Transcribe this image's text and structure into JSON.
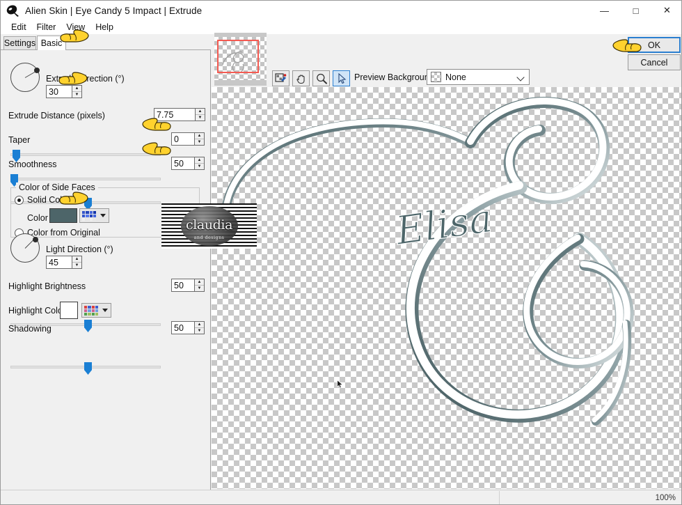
{
  "window": {
    "title": "Alien Skin | Eye Candy 5 Impact | Extrude",
    "app_icon": "alien-skin-icon",
    "minimize": "—",
    "maximize": "□",
    "close": "✕"
  },
  "menubar": {
    "items": [
      {
        "label": "Edit"
      },
      {
        "label": "Filter"
      },
      {
        "label": "View"
      },
      {
        "label": "Help"
      }
    ]
  },
  "tabs": [
    {
      "label": "Settings",
      "active": false
    },
    {
      "label": "Basic",
      "active": true
    }
  ],
  "settings": {
    "extrude_direction": {
      "label": "Extrude Direction (°)",
      "value": "30",
      "dial_angle_deg": 30
    },
    "extrude_distance": {
      "label": "Extrude Distance (pixels)",
      "value": "7.75",
      "slider_percent": 4
    },
    "taper": {
      "label": "Taper",
      "value": "0",
      "slider_percent": 0
    },
    "smoothness": {
      "label": "Smoothness",
      "value": "50",
      "slider_percent": 50
    },
    "color_of_side_faces": {
      "group_label": "Color of Side Faces",
      "solid_color_label": "Solid Color",
      "solid_color_selected": true,
      "color_label": "Color",
      "color_value": "#4d6569",
      "color_from_original_label": "Color from Original",
      "color_from_original_selected": false,
      "palette_button_name": "color-palette-dropdown"
    },
    "light_direction": {
      "label": "Light Direction (°)",
      "value": "45",
      "dial_angle_deg": 45
    },
    "highlight_brightness": {
      "label": "Highlight Brightness",
      "value": "50",
      "slider_percent": 50
    },
    "highlight_color": {
      "label": "Highlight Color",
      "value": "#ffffff",
      "palette_button_name": "highlight-color-palette-dropdown"
    },
    "shadowing": {
      "label": "Shadowing",
      "value": "50",
      "slider_percent": 50
    }
  },
  "toolbar": {
    "tools": [
      {
        "name": "eyedropper-tool",
        "active": false
      },
      {
        "name": "hand-tool",
        "active": false
      },
      {
        "name": "zoom-tool",
        "active": false
      },
      {
        "name": "pointer-tool",
        "active": true
      }
    ],
    "preview_background_label": "Preview Background:",
    "preview_background_value": "None"
  },
  "buttons": {
    "ok": "OK",
    "cancel": "Cancel"
  },
  "statusbar": {
    "zoom_level": "100%"
  },
  "preview": {
    "glyph_label": "Elisa",
    "glyph_description": "script-ampersand-monogram",
    "fill_color": "#ffffff",
    "side_face_color": "#4d6569"
  },
  "watermark": {
    "text": "claudia",
    "subtext": "and designs"
  },
  "colors": {
    "accent": "#2b7fd0",
    "slider_thumb": "#1a7fd4",
    "selection_box": "#f45b52",
    "panel_bg": "#f0f0f0"
  }
}
